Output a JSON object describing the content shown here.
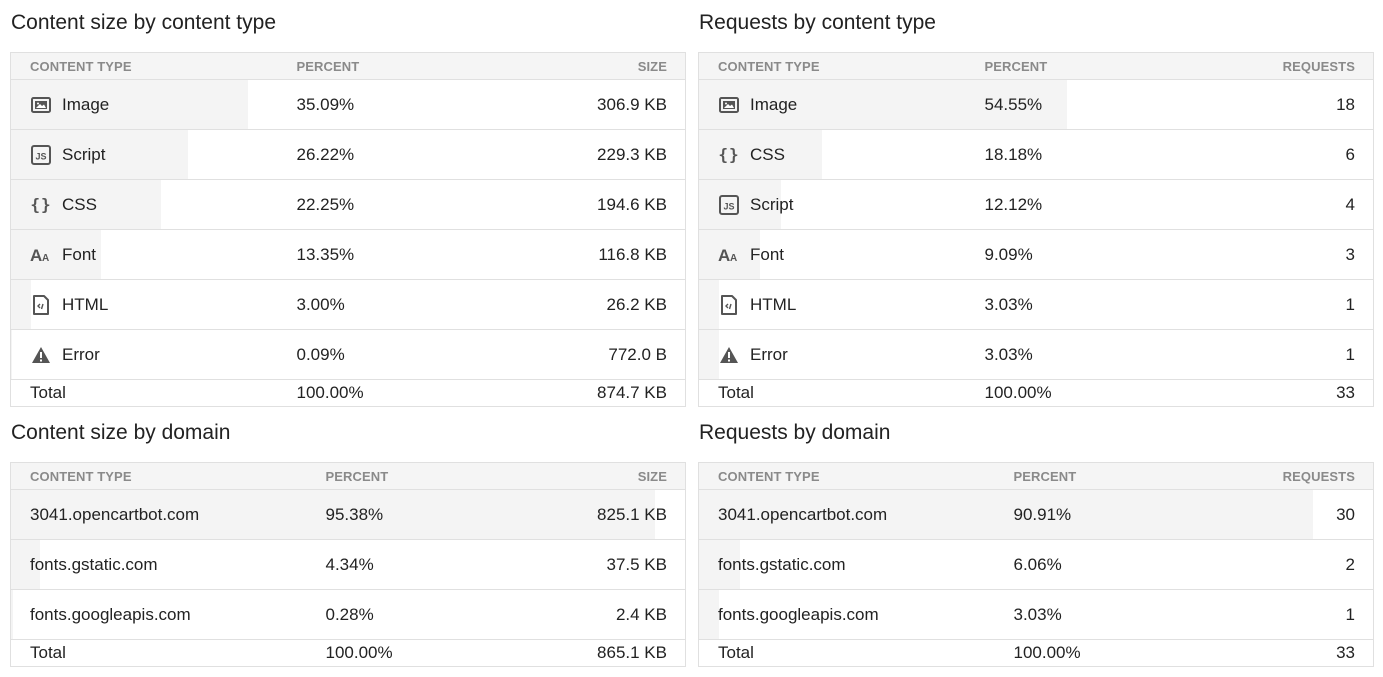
{
  "size_by_type": {
    "title": "Content size by content type",
    "columns": [
      "CONTENT TYPE",
      "PERCENT",
      "SIZE"
    ],
    "rows": [
      {
        "icon": "image-icon",
        "label": "Image",
        "percent": "35.09%",
        "value": "306.9 KB",
        "bar": 35.09
      },
      {
        "icon": "script-icon",
        "label": "Script",
        "percent": "26.22%",
        "value": "229.3 KB",
        "bar": 26.22
      },
      {
        "icon": "css-icon",
        "label": "CSS",
        "percent": "22.25%",
        "value": "194.6 KB",
        "bar": 22.25
      },
      {
        "icon": "font-icon",
        "label": "Font",
        "percent": "13.35%",
        "value": "116.8 KB",
        "bar": 13.35
      },
      {
        "icon": "html-icon",
        "label": "HTML",
        "percent": "3.00%",
        "value": "26.2 KB",
        "bar": 3.0
      },
      {
        "icon": "error-icon",
        "label": "Error",
        "percent": "0.09%",
        "value": "772.0 B",
        "bar": 0.09
      }
    ],
    "total": {
      "label": "Total",
      "percent": "100.00%",
      "value": "874.7 KB"
    }
  },
  "requests_by_type": {
    "title": "Requests by content type",
    "columns": [
      "CONTENT TYPE",
      "PERCENT",
      "REQUESTS"
    ],
    "rows": [
      {
        "icon": "image-icon",
        "label": "Image",
        "percent": "54.55%",
        "value": "18",
        "bar": 54.55
      },
      {
        "icon": "css-icon",
        "label": "CSS",
        "percent": "18.18%",
        "value": "6",
        "bar": 18.18
      },
      {
        "icon": "script-icon",
        "label": "Script",
        "percent": "12.12%",
        "value": "4",
        "bar": 12.12
      },
      {
        "icon": "font-icon",
        "label": "Font",
        "percent": "9.09%",
        "value": "3",
        "bar": 9.09
      },
      {
        "icon": "html-icon",
        "label": "HTML",
        "percent": "3.03%",
        "value": "1",
        "bar": 3.03
      },
      {
        "icon": "error-icon",
        "label": "Error",
        "percent": "3.03%",
        "value": "1",
        "bar": 3.03
      }
    ],
    "total": {
      "label": "Total",
      "percent": "100.00%",
      "value": "33"
    }
  },
  "size_by_domain": {
    "title": "Content size by domain",
    "columns": [
      "CONTENT TYPE",
      "PERCENT",
      "SIZE"
    ],
    "rows": [
      {
        "label": "3041.opencartbot.com",
        "percent": "95.38%",
        "value": "825.1 KB",
        "bar": 95.38
      },
      {
        "label": "fonts.gstatic.com",
        "percent": "4.34%",
        "value": "37.5 KB",
        "bar": 4.34
      },
      {
        "label": "fonts.googleapis.com",
        "percent": "0.28%",
        "value": "2.4 KB",
        "bar": 0.28
      }
    ],
    "total": {
      "label": "Total",
      "percent": "100.00%",
      "value": "865.1 KB"
    }
  },
  "requests_by_domain": {
    "title": "Requests by domain",
    "columns": [
      "CONTENT TYPE",
      "PERCENT",
      "REQUESTS"
    ],
    "rows": [
      {
        "label": "3041.opencartbot.com",
        "percent": "90.91%",
        "value": "30",
        "bar": 90.91
      },
      {
        "label": "fonts.gstatic.com",
        "percent": "6.06%",
        "value": "2",
        "bar": 6.06
      },
      {
        "label": "fonts.googleapis.com",
        "percent": "3.03%",
        "value": "1",
        "bar": 3.03
      }
    ],
    "total": {
      "label": "Total",
      "percent": "100.00%",
      "value": "33"
    }
  }
}
